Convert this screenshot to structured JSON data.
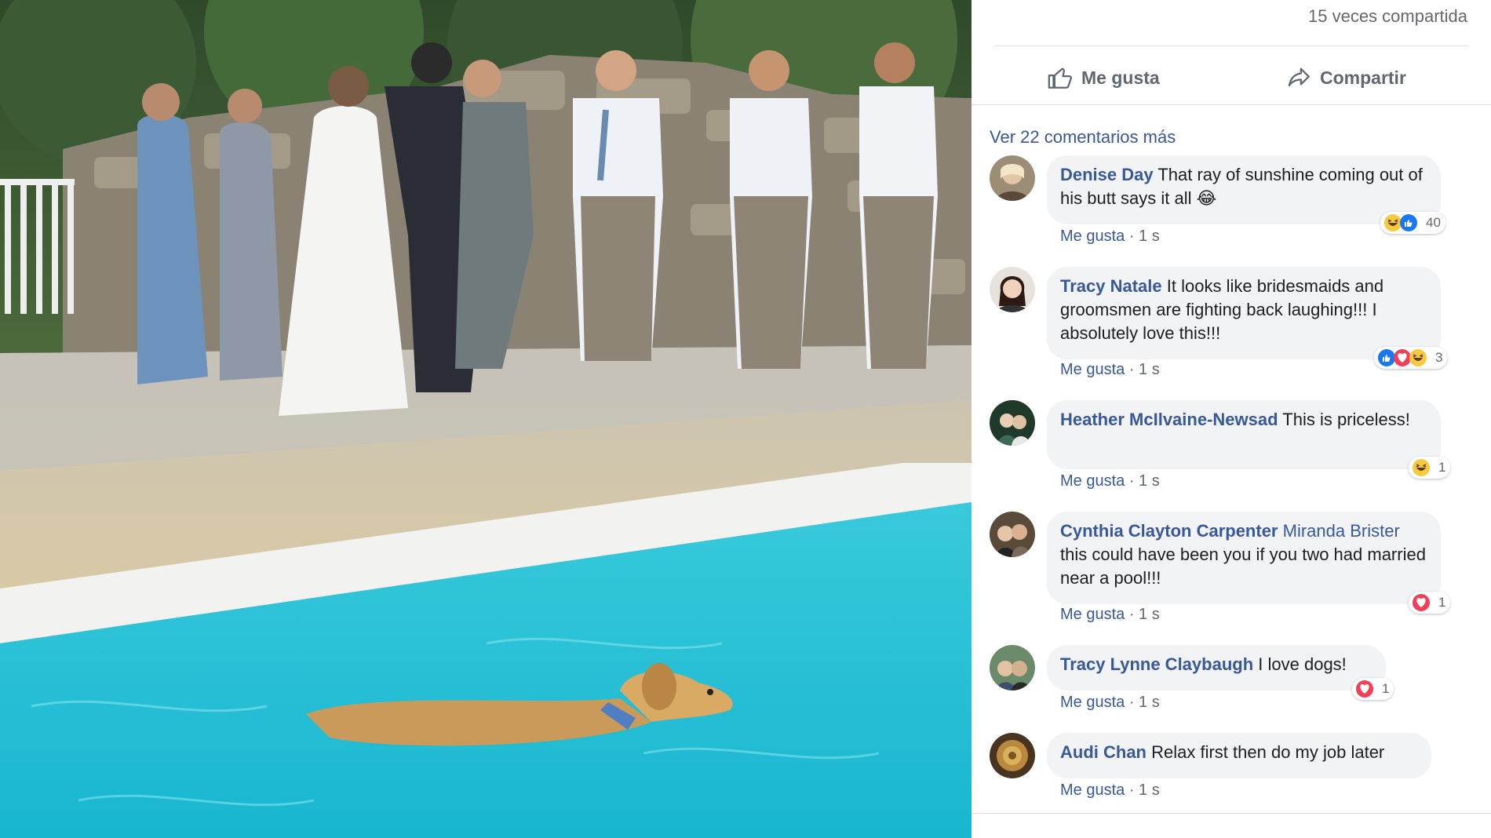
{
  "post": {
    "share_count_text": "15 veces compartida",
    "actions": {
      "like_label": "Me gusta",
      "share_label": "Compartir"
    },
    "more_comments_link": "Ver 22 comentarios más"
  },
  "comments": [
    {
      "author": "Denise Day",
      "mention": "",
      "text": "That ray of sunshine coming out of his butt says it all 😂",
      "like_label": "Me gusta",
      "time": "1 s",
      "reactions": [
        "haha",
        "like"
      ],
      "reaction_count": "40"
    },
    {
      "author": "Tracy Natale",
      "mention": "",
      "text": "It looks like bridesmaids and groomsmen are fighting back laughing!!! I absolutely love this!!!",
      "like_label": "Me gusta",
      "time": "1 s",
      "reactions": [
        "like",
        "love",
        "haha"
      ],
      "reaction_count": "3"
    },
    {
      "author": "Heather McIlvaine-Newsad",
      "mention": "",
      "text": "This is priceless!",
      "like_label": "Me gusta",
      "time": "1 s",
      "reactions": [
        "haha"
      ],
      "reaction_count": "1"
    },
    {
      "author": "Cynthia Clayton Carpenter",
      "mention": "Miranda Brister",
      "text": "this could have been you if you two had married near a pool!!!",
      "like_label": "Me gusta",
      "time": "1 s",
      "reactions": [
        "love"
      ],
      "reaction_count": "1"
    },
    {
      "author": "Tracy Lynne Claybaugh",
      "mention": "",
      "text": "I love dogs!",
      "like_label": "Me gusta",
      "time": "1 s",
      "reactions": [
        "love"
      ],
      "reaction_count": "1"
    },
    {
      "author": "Audi Chan",
      "mention": "",
      "text": "Relax first then do my job later",
      "like_label": "Me gusta",
      "time": "1 s",
      "reactions": [],
      "reaction_count": ""
    }
  ],
  "colors": {
    "link": "#385898",
    "meta": "#606770",
    "bubble": "#f2f3f5",
    "pool": "#2fc6d8"
  },
  "icons": {
    "like": "thumbs-up-icon",
    "share": "share-arrow-icon"
  }
}
